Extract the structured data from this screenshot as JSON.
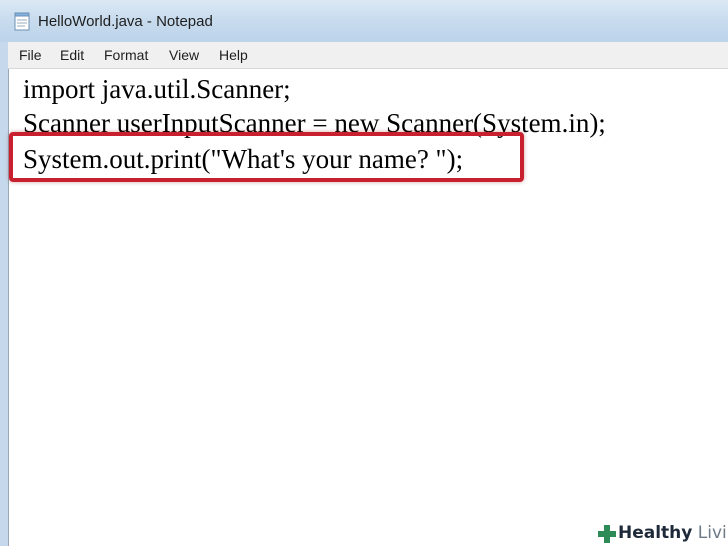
{
  "window": {
    "title": "HelloWorld.java - Notepad",
    "icon": "notepad-icon"
  },
  "menu": {
    "items": [
      "File",
      "Edit",
      "Format",
      "View",
      "Help"
    ]
  },
  "editor": {
    "lines": [
      "import java.util.Scanner;",
      "Scanner userInputScanner = new Scanner(System.in);",
      "System.out.print(\"What's your name? \");"
    ],
    "highlight_color": "#c8202e"
  },
  "watermark": {
    "brand_bold": "Healthy",
    "brand_light": "Living",
    "icon": "cross-icon",
    "icon_color": "#2e8b57"
  }
}
